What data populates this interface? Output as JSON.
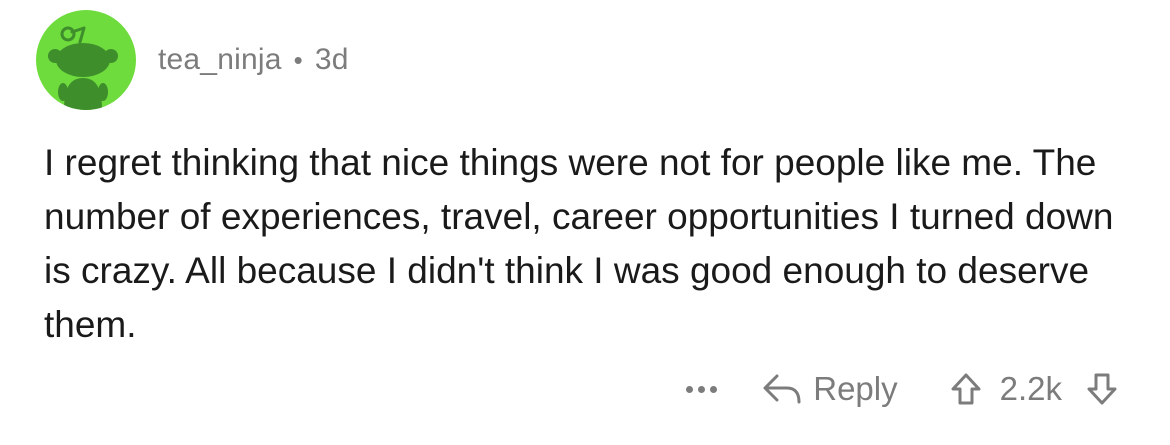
{
  "comment": {
    "author": "tea_ninja",
    "separator": "•",
    "age": "3d",
    "body": "I regret thinking that nice things were not for people like me. The number of experiences, travel, career opportunities I turned down is crazy. All because I didn't think I was good enough to deserve them.",
    "actions": {
      "more_icon": "more-dots-icon",
      "reply_icon": "reply-arrow-icon",
      "reply_label": "Reply",
      "upvote_icon": "upvote-arrow-icon",
      "score": "2.2k",
      "downvote_icon": "downvote-arrow-icon"
    }
  },
  "colors": {
    "avatar_bg": "#6fdc3e",
    "avatar_figure": "#3e8e2c",
    "meta_text": "#7c7c7c",
    "body_text": "#1a1a1b"
  }
}
